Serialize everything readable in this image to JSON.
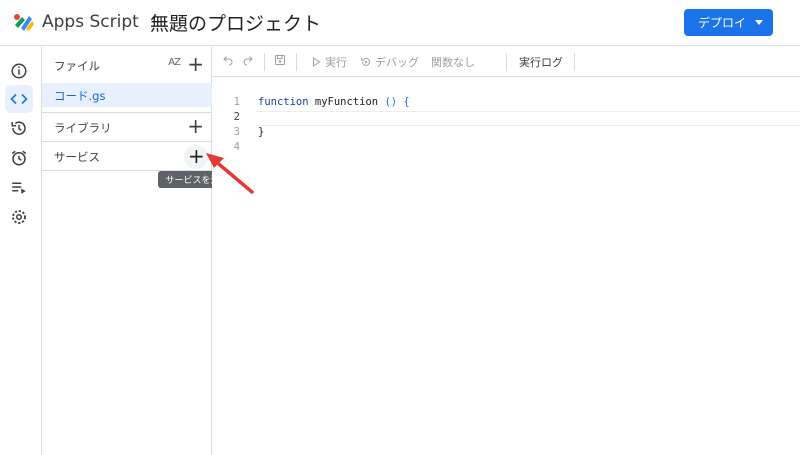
{
  "header": {
    "app_name": "Apps Script",
    "project_title": "無題のプロジェクト",
    "deploy_label": "デプロイ"
  },
  "colors": {
    "accent": "#1a73e8",
    "active_bg": "#e8f0fe",
    "arrow": "#e53935"
  },
  "rail": {
    "items": [
      {
        "icon": "info-icon"
      },
      {
        "icon": "code-icon",
        "active": true
      },
      {
        "icon": "history-icon"
      },
      {
        "icon": "alarm-icon"
      },
      {
        "icon": "executions-icon"
      },
      {
        "icon": "settings-icon"
      }
    ]
  },
  "panel": {
    "files_label": "ファイル",
    "sort_label": "AZ",
    "files": [
      {
        "name": "コード.gs",
        "selected": true
      }
    ],
    "libraries_label": "ライブラリ",
    "services_label": "サービス",
    "add_symbol": "+",
    "tooltip": "サービスを追加"
  },
  "toolbar": {
    "run_label": "実行",
    "debug_label": "デバッグ",
    "function_label": "関数なし",
    "log_label": "実行ログ"
  },
  "editor": {
    "lines": [
      {
        "num": "1",
        "keyword": "function",
        "name": " myFunction",
        "paren": "() {"
      },
      {
        "num": "2"
      },
      {
        "num": "3",
        "paren": "}"
      },
      {
        "num": "4"
      }
    ]
  }
}
